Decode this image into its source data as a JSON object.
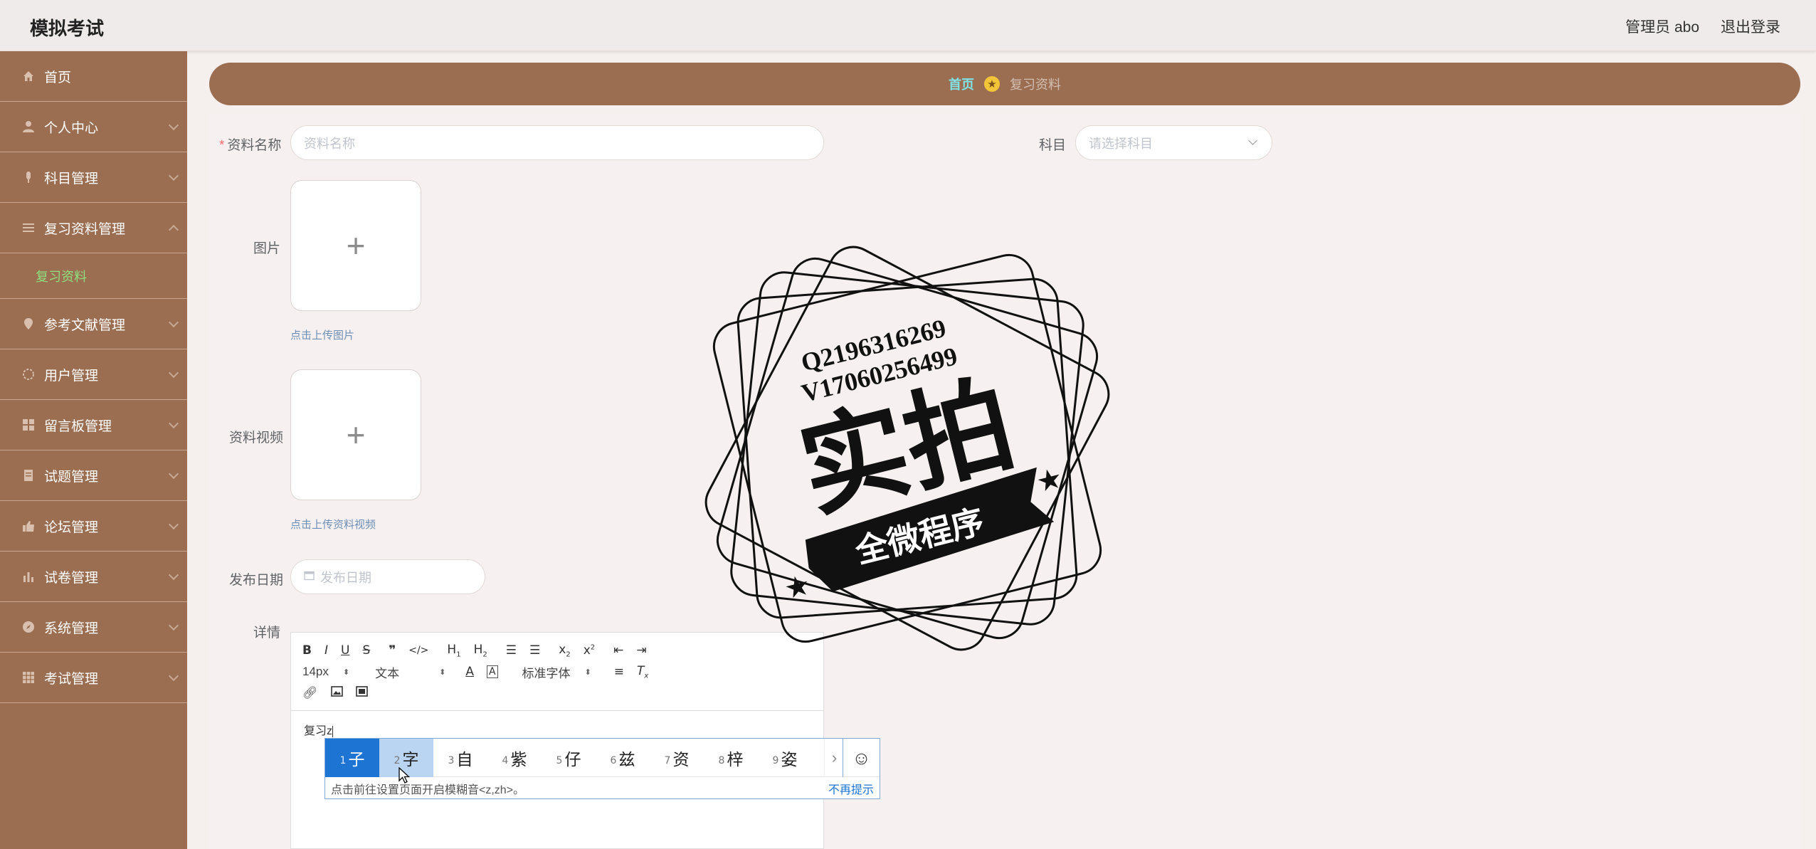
{
  "app": {
    "title": "模拟考试"
  },
  "topbar": {
    "user": "管理员 abo",
    "logout": "退出登录"
  },
  "sidebar": {
    "items": [
      {
        "label": "首页",
        "icon": "home-icon",
        "has_children": false
      },
      {
        "label": "个人中心",
        "icon": "user-icon",
        "has_children": true
      },
      {
        "label": "科目管理",
        "icon": "microphone-icon",
        "has_children": true
      },
      {
        "label": "复习资料管理",
        "icon": "list-icon",
        "has_children": true
      },
      {
        "label": "复习资料",
        "icon": "",
        "sub": true,
        "active": true
      },
      {
        "label": "参考文献管理",
        "icon": "location-icon",
        "has_children": true
      },
      {
        "label": "用户管理",
        "icon": "gear-outline-icon",
        "has_children": true
      },
      {
        "label": "留言板管理",
        "icon": "grid-icon",
        "has_children": true
      },
      {
        "label": "试题管理",
        "icon": "document-icon",
        "has_children": true
      },
      {
        "label": "论坛管理",
        "icon": "thumb-up-icon",
        "has_children": true
      },
      {
        "label": "试卷管理",
        "icon": "bar-chart-icon",
        "has_children": true
      },
      {
        "label": "系统管理",
        "icon": "compass-icon",
        "has_children": true
      },
      {
        "label": "考试管理",
        "icon": "grid-icon",
        "has_children": true
      }
    ]
  },
  "breadcrumb": {
    "home": "首页",
    "current": "复习资料"
  },
  "form": {
    "name_label": "资料名称",
    "name_placeholder": "资料名称",
    "subject_label": "科目",
    "subject_placeholder": "请选择科目",
    "image_label": "图片",
    "image_hint": "点击上传图片",
    "video_label": "资料视频",
    "video_hint": "点击上传资料视频",
    "date_label": "发布日期",
    "date_placeholder": "发布日期",
    "detail_label": "详情"
  },
  "editor": {
    "font_size": "14px",
    "block_type": "文本",
    "font_family": "标准字体",
    "content": "复习z"
  },
  "ime": {
    "candidates": [
      {
        "n": "1",
        "c": "子"
      },
      {
        "n": "2",
        "c": "字"
      },
      {
        "n": "3",
        "c": "自"
      },
      {
        "n": "4",
        "c": "紫"
      },
      {
        "n": "5",
        "c": "仔"
      },
      {
        "n": "6",
        "c": "兹"
      },
      {
        "n": "7",
        "c": "资"
      },
      {
        "n": "8",
        "c": "梓"
      },
      {
        "n": "9",
        "c": "姿"
      }
    ],
    "tip": "点击前往设置页面开启模糊音<z,zh>。",
    "dismiss": "不再提示"
  },
  "watermark": {
    "line1": "Q2196316269",
    "line2": "V17060256499",
    "big": "实拍",
    "banner": "全微程序"
  }
}
